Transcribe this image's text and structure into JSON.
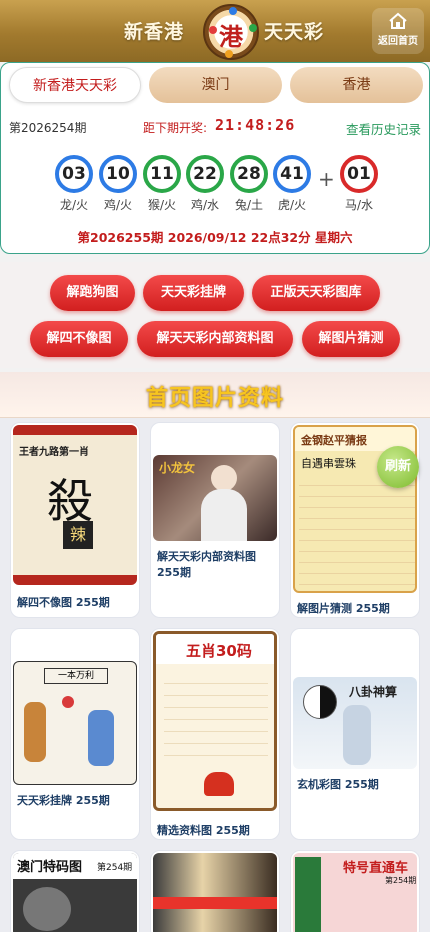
{
  "header": {
    "title_left": "新香港",
    "title_right": "天天彩",
    "logo_char": "港",
    "home_label": "返回首页"
  },
  "tabs": [
    "新香港天天彩",
    "澳门",
    "香港"
  ],
  "draw": {
    "period": "第2026254期",
    "countdown_label": "距下期开奖:",
    "countdown": "21:48:26",
    "history_link": "查看历史记录",
    "balls": [
      {
        "num": "03",
        "label": "龙/火",
        "color": "blue"
      },
      {
        "num": "10",
        "label": "鸡/火",
        "color": "blue"
      },
      {
        "num": "11",
        "label": "猴/火",
        "color": "green"
      },
      {
        "num": "22",
        "label": "鸡/水",
        "color": "green"
      },
      {
        "num": "28",
        "label": "兔/土",
        "color": "green"
      },
      {
        "num": "41",
        "label": "虎/火",
        "color": "blue"
      }
    ],
    "plus": "+",
    "special": {
      "num": "01",
      "label": "马/水",
      "color": "red"
    },
    "next_draw": "第2026255期 2026/09/12 22点32分 星期六"
  },
  "menu": [
    "解跑狗图",
    "天天彩挂牌",
    "正版天天彩图库",
    "解四不像图",
    "解天天彩内部资料图",
    "解图片猜测"
  ],
  "section_title": "首页图片资料",
  "refresh_label": "刷新",
  "cards": [
    {
      "caption": "解四不像图 255期",
      "img_top": "王者九路第一肖",
      "img_big": "殺",
      "img_small": "辣"
    },
    {
      "caption": "解天天彩内部资料图 255期",
      "img_top": "小龙女"
    },
    {
      "caption": "解图片猜测 255期",
      "img_top": "金钢赵平猜报",
      "img_sub": "自遇串雲珠"
    },
    {
      "caption": "天天彩挂牌 255期",
      "img_top": "一本万利"
    },
    {
      "caption": "精选资料图 255期",
      "img_top": "五肖30码"
    },
    {
      "caption": "玄机彩图 255期",
      "img_top": "八卦神算"
    },
    {
      "caption": "",
      "img_top": "澳门特码图",
      "img_sub": "第254期"
    },
    {
      "caption": "",
      "img_top": ""
    },
    {
      "caption": "",
      "img_top": "特号直通车",
      "img_sub": "第254期"
    }
  ]
}
